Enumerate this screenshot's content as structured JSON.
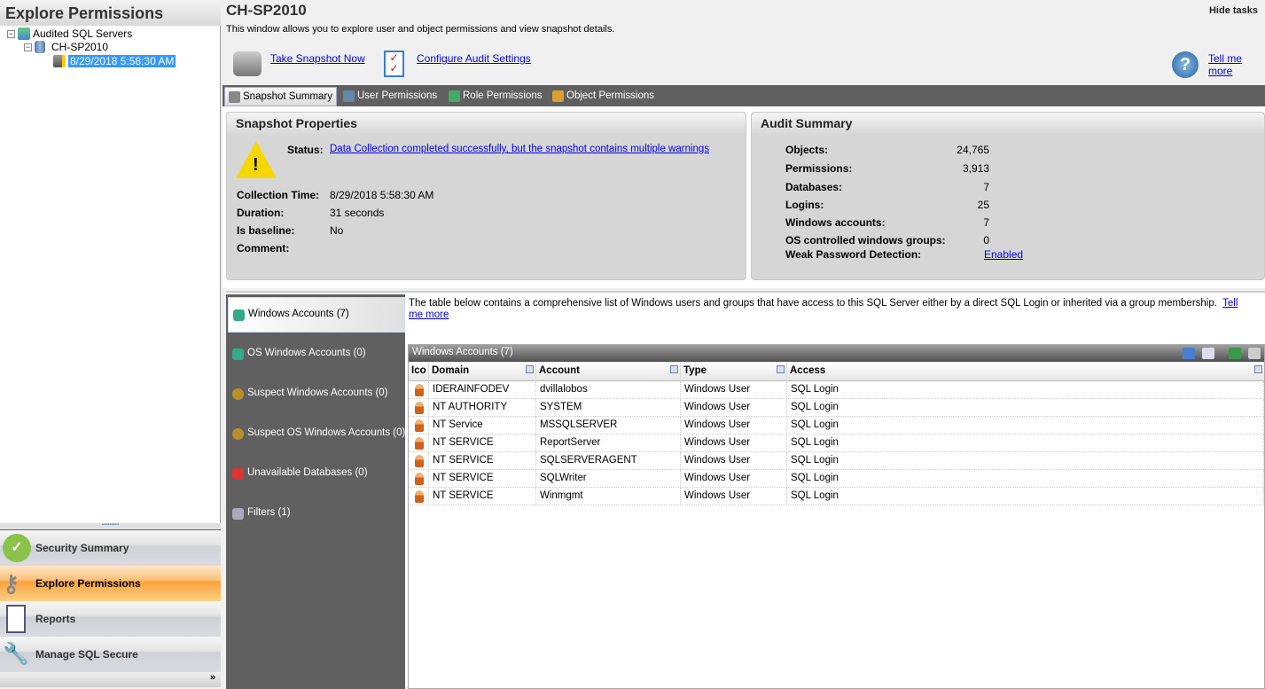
{
  "left": {
    "title": "Explore Permissions",
    "tree": [
      {
        "label": "Audited SQL Servers"
      },
      {
        "label": "CH-SP2010"
      },
      {
        "label": "8/29/2018 5:58:30 AM"
      }
    ],
    "nav": [
      {
        "label": "Security Summary"
      },
      {
        "label": "Explore Permissions"
      },
      {
        "label": "Reports"
      },
      {
        "label": "Manage SQL Secure"
      }
    ],
    "more": "»"
  },
  "header": {
    "title": "CH-SP2010",
    "hide_tasks": "Hide tasks",
    "description": "This window allows you to explore user and object permissions and view snapshot details.",
    "take_snapshot": "Take Snapshot Now",
    "configure_audit": "Configure Audit Settings",
    "tell_me_more": "Tell me more"
  },
  "tabs": [
    {
      "label": "Snapshot Summary"
    },
    {
      "label": "User Permissions"
    },
    {
      "label": "Role Permissions"
    },
    {
      "label": "Object Permissions"
    }
  ],
  "snapshot": {
    "title": "Snapshot Properties",
    "status_label": "Status:",
    "status_value": "Data Collection completed successfully, but the snapshot contains multiple warnings",
    "fields": [
      {
        "label": "Collection Time:",
        "value": "8/29/2018 5:58:30 AM"
      },
      {
        "label": "Duration:",
        "value": "31 seconds"
      },
      {
        "label": "Is baseline:",
        "value": "No"
      },
      {
        "label": "Comment:",
        "value": ""
      }
    ]
  },
  "audit": {
    "title": "Audit Summary",
    "fields": [
      {
        "label": "Objects:",
        "value": "24,765"
      },
      {
        "label": "Permissions:",
        "value": "3,913"
      },
      {
        "label": "Databases:",
        "value": "7"
      },
      {
        "label": "Logins:",
        "value": "25"
      },
      {
        "label": "Windows accounts:",
        "value": "7"
      },
      {
        "label": "OS controlled windows groups:",
        "value": "0"
      }
    ],
    "weak_label": "Weak Password Detection:",
    "weak_value": "Enabled"
  },
  "categories": [
    {
      "label": "Windows Accounts (7)"
    },
    {
      "label": "OS Windows Accounts (0)"
    },
    {
      "label": "Suspect Windows Accounts (0)"
    },
    {
      "label": "Suspect OS Windows Accounts (0)"
    },
    {
      "label": "Unavailable Databases (0)"
    },
    {
      "label": "Filters (1)"
    }
  ],
  "grid": {
    "description": "The table below contains a comprehensive list of Windows users and groups that have access to this SQL Server either by a direct SQL Login or inherited via a group membership.",
    "tell_me": "Tell me more",
    "title": "Windows Accounts (7)",
    "columns": [
      "Ico",
      "Domain",
      "Account",
      "Type",
      "Access"
    ],
    "rows": [
      [
        "IDERAINFODEV",
        "dvillalobos",
        "Windows User",
        "SQL Login"
      ],
      [
        "NT AUTHORITY",
        "SYSTEM",
        "Windows User",
        "SQL Login"
      ],
      [
        "NT Service",
        "MSSQLSERVER",
        "Windows User",
        "SQL Login"
      ],
      [
        "NT SERVICE",
        "ReportServer",
        "Windows User",
        "SQL Login"
      ],
      [
        "NT SERVICE",
        "SQLSERVERAGENT",
        "Windows User",
        "SQL Login"
      ],
      [
        "NT SERVICE",
        "SQLWriter",
        "Windows User",
        "SQL Login"
      ],
      [
        "NT SERVICE",
        "Winmgmt",
        "Windows User",
        "SQL Login"
      ]
    ]
  }
}
